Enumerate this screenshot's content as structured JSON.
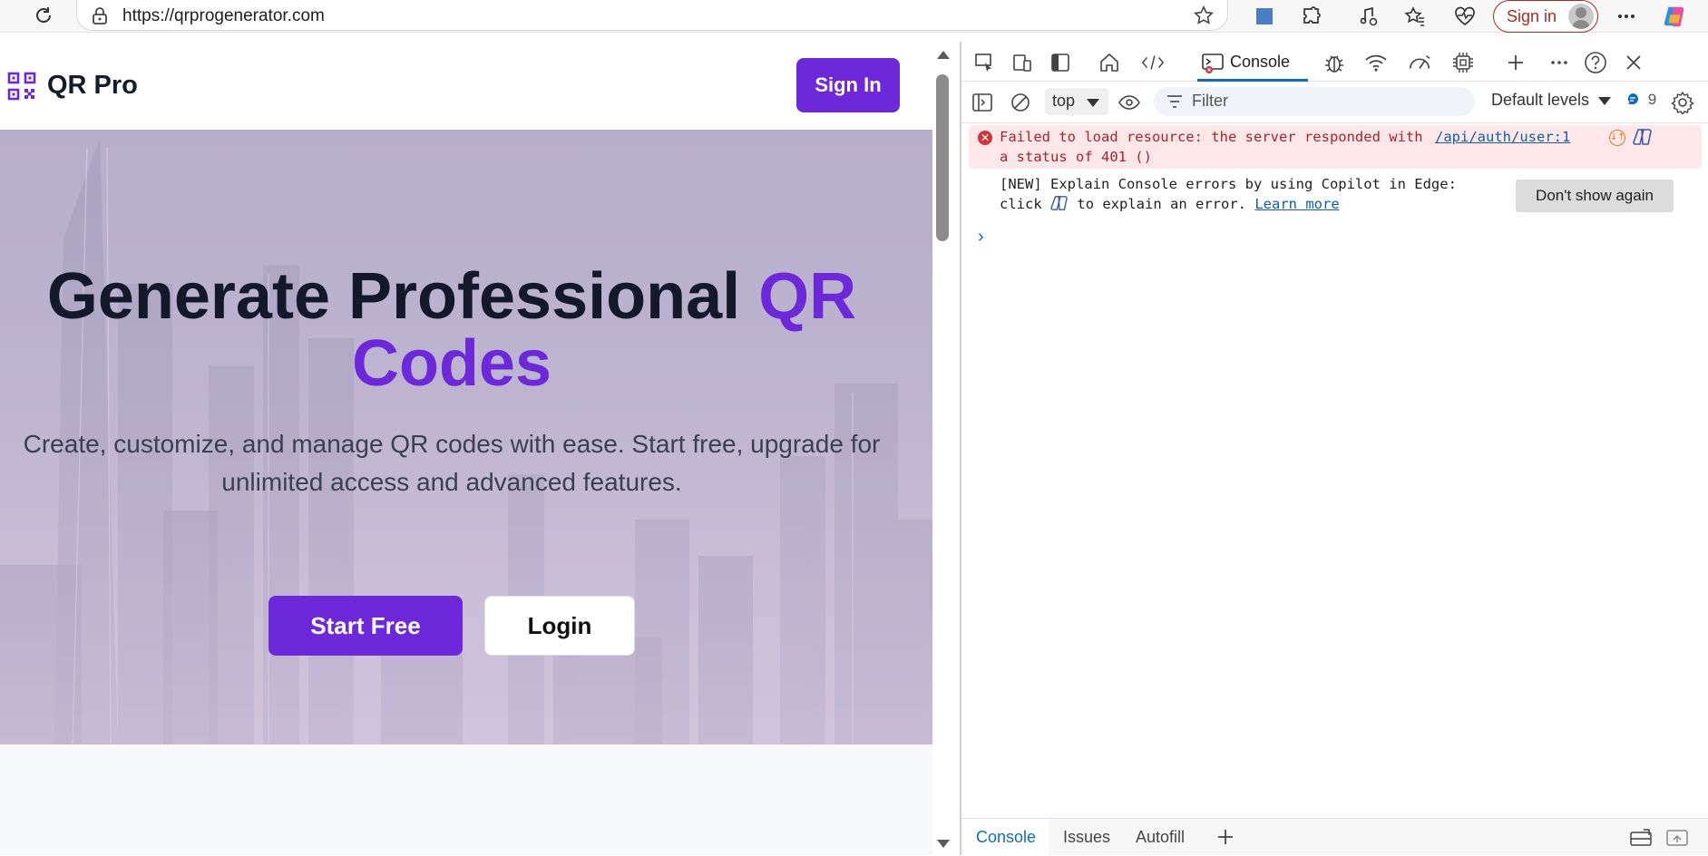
{
  "browser": {
    "url": "https://qrprogenerator.com",
    "sign_in_label": "Sign in"
  },
  "site": {
    "logo_text": "QR Pro",
    "sign_in_button": "Sign In",
    "hero": {
      "title_main": "Generate Professional",
      "title_accent_1": "QR",
      "title_accent_2": "Codes",
      "subtitle_line1": "Create, customize, and manage QR codes with ease. Start free, upgrade for",
      "subtitle_line2": "unlimited access and advanced features.",
      "start_button": "Start Free",
      "login_button": "Login"
    },
    "colors": {
      "accent": "#6d28d9",
      "title": "#14182b"
    }
  },
  "devtools": {
    "active_tab": "Console",
    "context": "top",
    "filter_placeholder": "Filter",
    "levels": "Default levels",
    "message_count": "9",
    "error": {
      "line1": "Failed to load resource: the server responded with",
      "link": "/api/auth/user:1",
      "line2": "a status of 401 ()"
    },
    "info": {
      "line1": "[NEW] Explain Console errors by using Copilot in Edge:",
      "line2_pre": "click",
      "line2_post": "to explain an error.",
      "link": "Learn more",
      "button": "Don't show again"
    },
    "bottom_tabs": [
      "Console",
      "Issues",
      "Autofill"
    ],
    "colors": {
      "error_bg": "#fde7e9",
      "error_text": "#a4262c",
      "link": "#0f5fa6",
      "active": "#0f6cbd"
    }
  }
}
